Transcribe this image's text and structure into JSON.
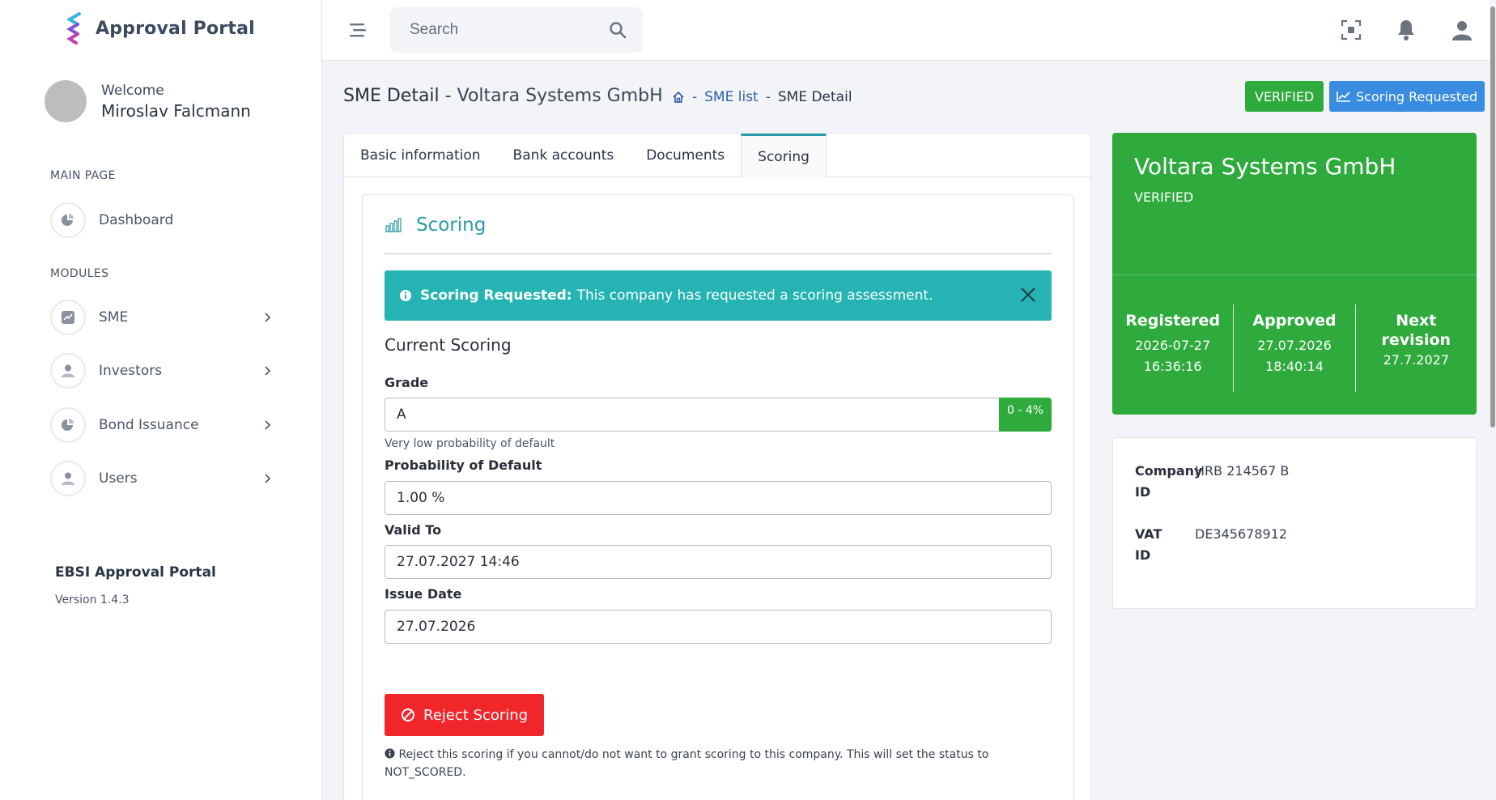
{
  "brand": {
    "name": "Approval Portal"
  },
  "user": {
    "welcome_label": "Welcome",
    "name": "Miroslav Falcmann"
  },
  "sidebar": {
    "section_main": "MAIN PAGE",
    "section_modules": "MODULES",
    "items": [
      {
        "label": "Dashboard"
      },
      {
        "label": "SME"
      },
      {
        "label": "Investors"
      },
      {
        "label": "Bond Issuance"
      },
      {
        "label": "Users"
      }
    ],
    "footer_title": "EBSI Approval Portal",
    "footer_version": "Version 1.4.3"
  },
  "topbar": {
    "search_placeholder": "Search"
  },
  "page": {
    "title": "SME Detail",
    "dash": "-",
    "company": "Voltara Systems GmbH",
    "breadcrumb": [
      "SME list",
      "SME Detail"
    ],
    "breadcrumb_sep": "-",
    "badge_verified": "VERIFIED",
    "badge_scoring": "Scoring Requested"
  },
  "tabs": [
    {
      "label": "Basic information"
    },
    {
      "label": "Bank accounts"
    },
    {
      "label": "Documents"
    },
    {
      "label": "Scoring"
    }
  ],
  "scoring": {
    "title": "Scoring",
    "alert_strong": "Scoring Requested:",
    "alert_msg": "This company has requested a scoring assessment.",
    "current_title": "Current Scoring",
    "grade_label": "Grade",
    "grade_value": "A",
    "grade_range": "0 - 4%",
    "grade_hint": "Very low probability of default",
    "pod_label": "Probability of Default",
    "pod_value": "1.00 %",
    "valid_label": "Valid To",
    "valid_value": "27.07.2027 14:46",
    "issue_label": "Issue Date",
    "issue_value": "27.07.2026",
    "reject_label": "Reject Scoring",
    "reject_note": "Reject this scoring if you cannot/do not want to grant scoring to this company. This will set the status to NOT_SCORED."
  },
  "company_card": {
    "name": "Voltara Systems GmbH",
    "status": "VERIFIED",
    "stats": [
      {
        "label": "Registered",
        "value_line1": "2026-07-27",
        "value_line2": "16:36:16"
      },
      {
        "label": "Approved",
        "value_line1": "27.07.2026",
        "value_line2": "18:40:14"
      },
      {
        "label_line1": "Next",
        "label_line2": "revision",
        "value_line1": "27.7.2027"
      }
    ]
  },
  "ids": {
    "company_label_1": "Company",
    "company_label_2": "ID",
    "company_value": "HRB 214567 B",
    "vat_label_1": "VAT",
    "vat_label_2": "ID",
    "vat_value": "DE345678912"
  },
  "colors": {
    "accent_teal": "#2b9aaa",
    "verified_green": "#2eab3c",
    "info_blue": "#3a8ce0",
    "danger_red": "#f0262a",
    "alert_teal": "#26b3b3"
  }
}
